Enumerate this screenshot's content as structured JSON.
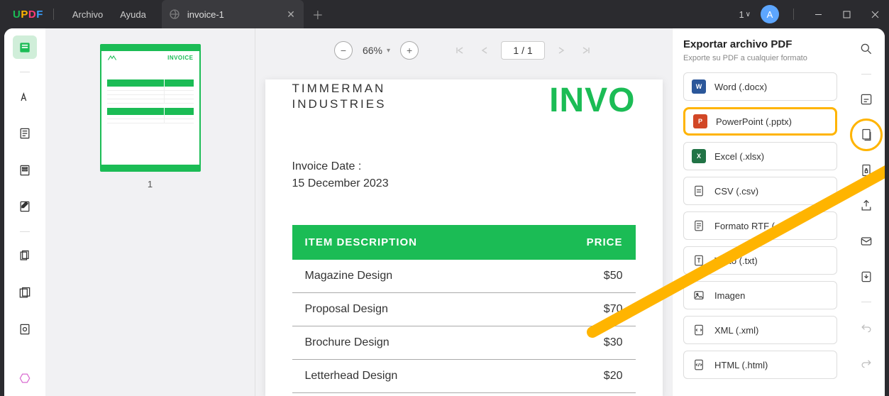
{
  "titlebar": {
    "menu_file": "Archivo",
    "menu_help": "Ayuda",
    "tab_title": "invoice-1",
    "count": "1",
    "avatar_letter": "A"
  },
  "thumb": {
    "page_number": "1",
    "invoice_label": "INVOICE"
  },
  "controls": {
    "zoom": "66%",
    "page": "1 / 1"
  },
  "document": {
    "company_line1": "TIMMERMAN",
    "company_line2": "INDUSTRIES",
    "title": "INVO",
    "date_label": "Invoice Date :",
    "date_value": "15 December 2023",
    "col_desc": "ITEM DESCRIPTION",
    "col_price": "PRICE",
    "rows": [
      {
        "desc": "Magazine Design",
        "price": "$50"
      },
      {
        "desc": "Proposal Design",
        "price": "$70"
      },
      {
        "desc": "Brochure Design",
        "price": "$30"
      },
      {
        "desc": "Letterhead Design",
        "price": "$20"
      }
    ]
  },
  "export": {
    "title": "Exportar archivo PDF",
    "subtitle": "Exporte su PDF a cualquier formato",
    "options": [
      {
        "label": "Word (.docx)",
        "icon": "w"
      },
      {
        "label": "PowerPoint (.pptx)",
        "icon": "p"
      },
      {
        "label": "Excel (.xlsx)",
        "icon": "x"
      },
      {
        "label": "CSV (.csv)",
        "icon": "generic"
      },
      {
        "label": "Formato RTF (.rtf)",
        "icon": "generic"
      },
      {
        "label": "Texto (.txt)",
        "icon": "generic"
      },
      {
        "label": "Imagen",
        "icon": "generic"
      },
      {
        "label": "XML (.xml)",
        "icon": "generic"
      },
      {
        "label": "HTML (.html)",
        "icon": "generic"
      }
    ]
  }
}
